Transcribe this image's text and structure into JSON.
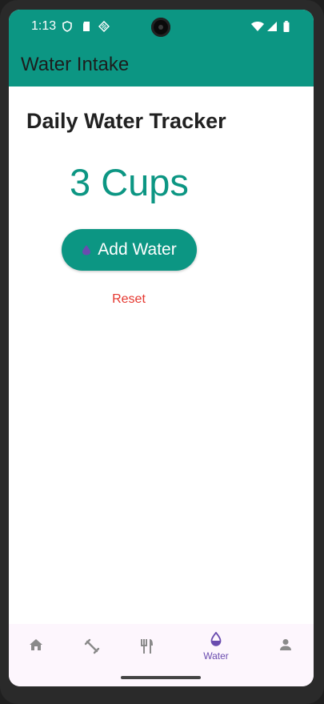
{
  "status_bar": {
    "time": "1:13",
    "icons_left": [
      "shield-icon",
      "sd-card-icon",
      "signal-diamond-icon"
    ],
    "icons_right": [
      "wifi-icon",
      "cell-signal-icon",
      "battery-icon"
    ]
  },
  "app_bar": {
    "title": "Water Intake"
  },
  "main": {
    "title": "Daily Water Tracker",
    "cups_display": "3 Cups",
    "add_button_label": "Add Water",
    "add_button_icon": "water-drop-icon",
    "reset_label": "Reset"
  },
  "bottom_nav": {
    "items": [
      {
        "icon": "home-icon",
        "label": ""
      },
      {
        "icon": "fitness-icon",
        "label": ""
      },
      {
        "icon": "restaurant-icon",
        "label": ""
      },
      {
        "icon": "water-drop-icon",
        "label": "Water",
        "selected": true
      },
      {
        "icon": "person-icon",
        "label": ""
      }
    ]
  },
  "colors": {
    "primary": "#0c9683",
    "reset": "#e5372f",
    "nav_selected": "#6a4caf",
    "nav_background": "#fdf6fd"
  }
}
